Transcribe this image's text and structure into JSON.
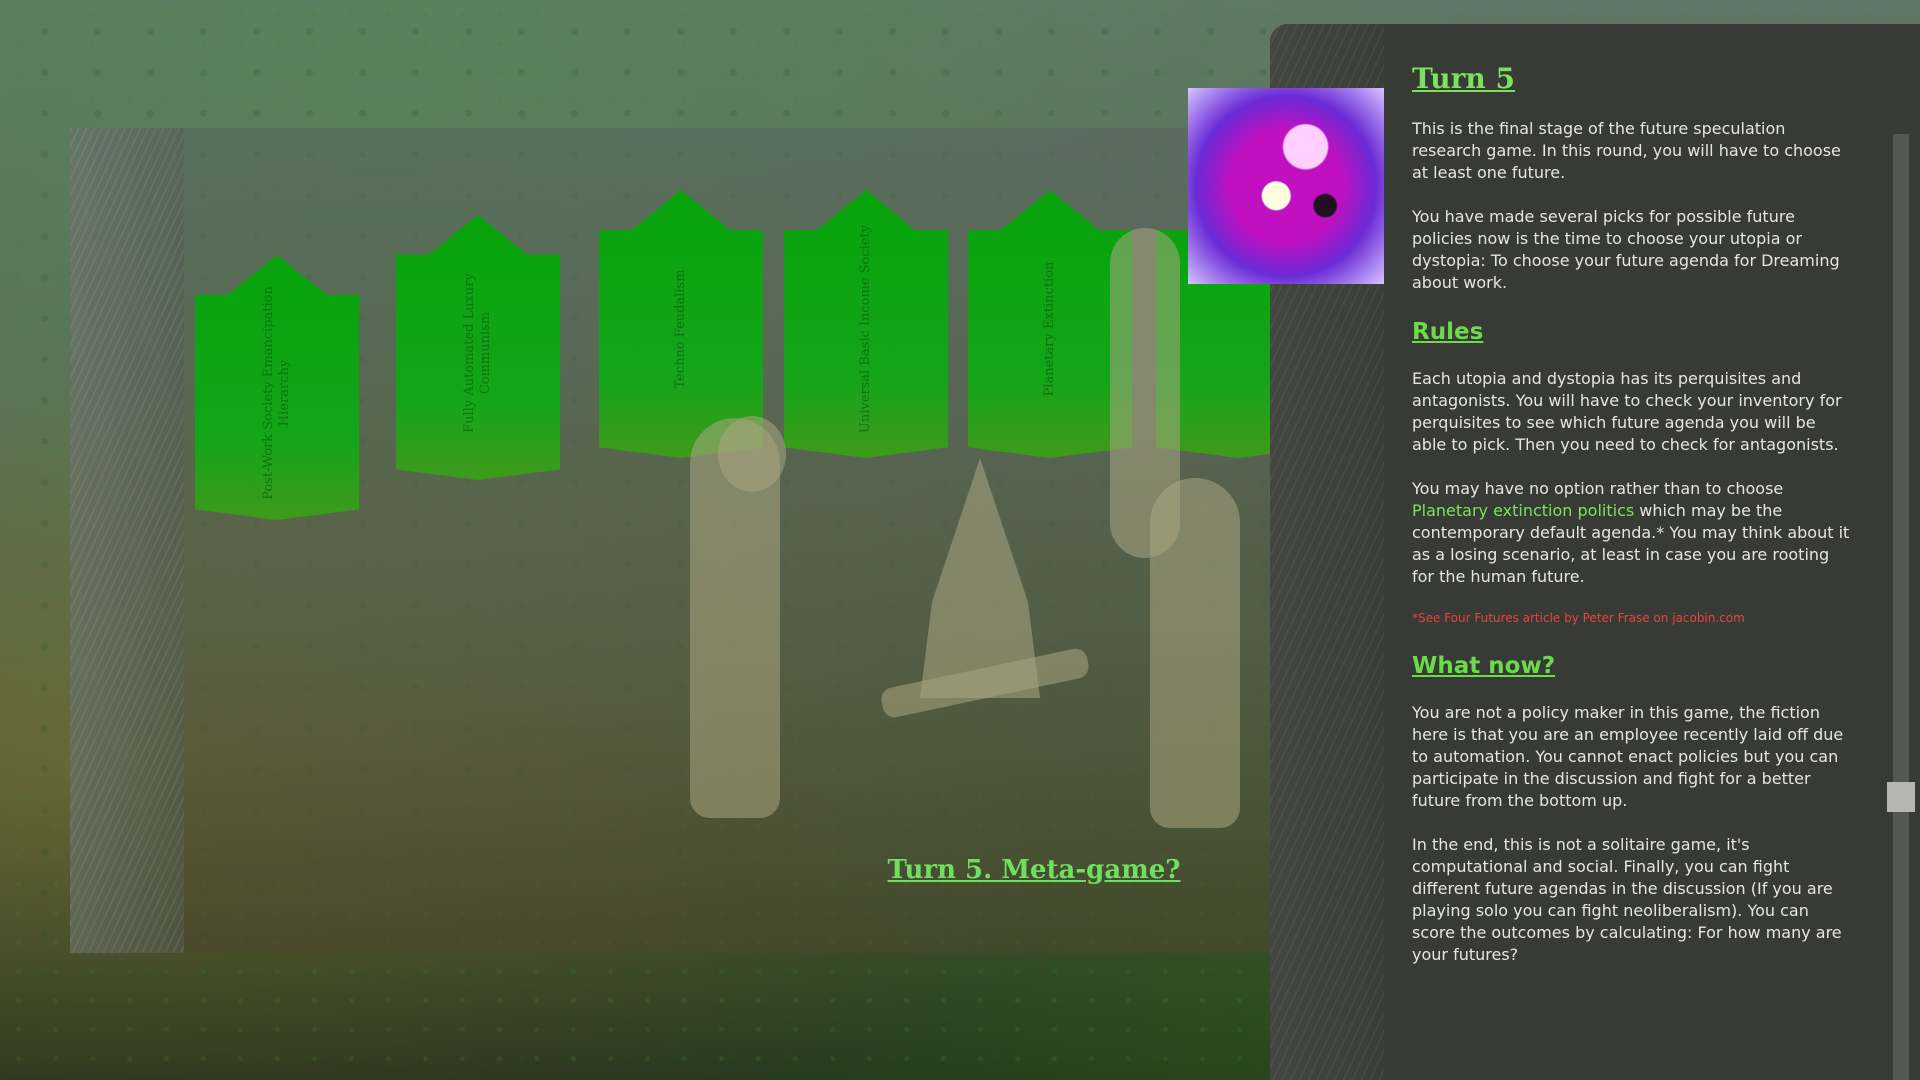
{
  "scene": {
    "title": "Turn 5. Meta-game?",
    "cards": [
      {
        "text": "Post-Work Society Emancipation Hierarchy"
      },
      {
        "text": "Fully Automated Luxury Communism"
      },
      {
        "text": "Techno Feudalism"
      },
      {
        "text": "Universal Basic Income Society"
      },
      {
        "text": "Planetary Extinction"
      },
      {
        "text": ""
      }
    ]
  },
  "panel": {
    "title": "Turn 5",
    "intro": "This is the final stage of the future speculation research game. In this round, you will have to choose at least one future.",
    "intro2": "You have made several picks for possible future policies now is the time to choose your utopia or dystopia: To choose your future agenda for Dreaming about work.",
    "rules_heading": "Rules",
    "rules_p1": "Each utopia and dystopia has its perquisites and antagonists. You will have to check your inventory for perquisites to see which future agenda you will be able to pick. Then you need to check for antagonists.",
    "rules_p2_before": "You may have no option rather than to choose ",
    "rules_p2_link": "Planetary extinction politics",
    "rules_p2_after": " which may be the contemporary default agenda.* You may think about it as a losing scenario, at least in case you are rooting for the human future.",
    "footnote": "*See Four Futures article by Peter Frase on jacobin.com",
    "whatnow_heading": "What now?",
    "whatnow_p1": "You are not a policy maker in this game, the fiction here is that you are an employee recently laid off due to automation. You cannot enact policies but you can participate in the discussion and fight for a better future from the bottom up.",
    "whatnow_p2": "In the end, this is not a solitaire game, it's computational and social. Finally, you can fight different future agendas in the discussion (If you are playing solo you can fight neoliberalism). You can score the outcomes by calculating: For how many are your futures?"
  },
  "colors": {
    "accent": "#7be35b",
    "card_green": "#07a30a",
    "panel_bg": "#383a36",
    "footnote": "#e2463c"
  }
}
